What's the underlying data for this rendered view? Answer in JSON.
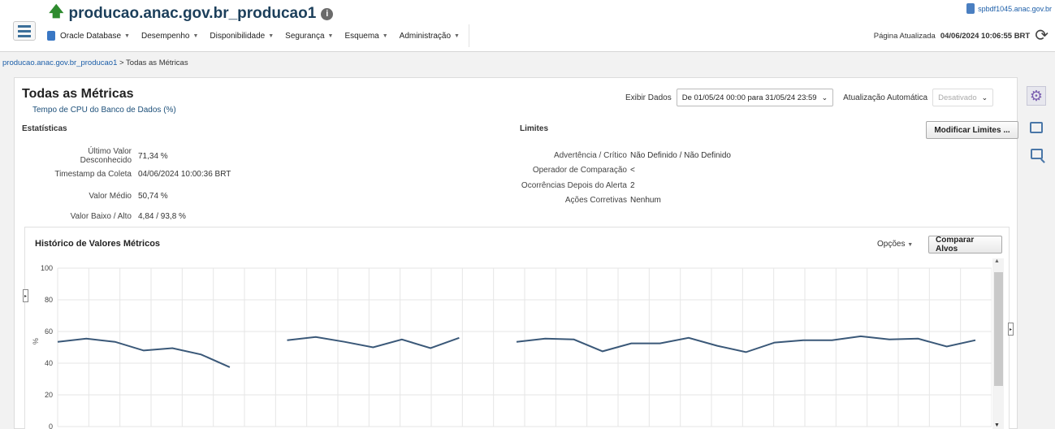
{
  "header": {
    "target_name": "producao.anac.gov.br_producao1",
    "host": "spbdf1045.anac.gov.br",
    "menus": [
      {
        "label": "Oracle Database"
      },
      {
        "label": "Desempenho"
      },
      {
        "label": "Disponibilidade"
      },
      {
        "label": "Segurança"
      },
      {
        "label": "Esquema"
      },
      {
        "label": "Administração"
      }
    ],
    "refresh_label": "Página Atualizada",
    "refresh_time": "04/06/2024 10:06:55 BRT"
  },
  "breadcrumb": {
    "link": "producao.anac.gov.br_producao1",
    "separator": " > ",
    "current": "Todas as Métricas"
  },
  "page": {
    "title": "Todas as Métricas",
    "metric": "Tempo de CPU do Banco de Dados (%)",
    "exibir_label": "Exibir Dados",
    "exibir_value": "De 01/05/24 00:00 para 31/05/24 23:59",
    "auto_label": "Atualização Automática",
    "auto_value": "Desativado"
  },
  "stats": {
    "heading": "Estatísticas",
    "rows": [
      {
        "label": "Último Valor Desconhecido",
        "label_line1": "Último Valor",
        "label_line2": "Desconhecido",
        "value": "71,34 %"
      },
      {
        "label": "Timestamp da Coleta",
        "value": "04/06/2024 10:00:36 BRT"
      },
      {
        "label": "Valor Médio",
        "value": "50,74 %"
      },
      {
        "label": "Valor Baixo / Alto",
        "value": "4,84 / 93,8 %"
      }
    ]
  },
  "limits": {
    "heading": "Limites",
    "modify_button": "Modificar Limites ...",
    "rows": [
      {
        "label": "Advertência / Crítico",
        "value": "Não Definido / Não Definido"
      },
      {
        "label": "Operador de Comparação",
        "value": "<"
      },
      {
        "label": "Ocorrências Depois do Alerta",
        "value": "2"
      },
      {
        "label": "Ações Corretivas",
        "value": "Nenhum"
      }
    ]
  },
  "chart_section": {
    "title": "Histórico de Valores Métricos",
    "options_label": "Opções",
    "compare_button": "Comparar Alvos"
  },
  "colors": {
    "line": "#3a5878",
    "grid": "#e6e6e6",
    "title": "#1c3f5b"
  },
  "chart_data": {
    "type": "line",
    "ylabel": "%",
    "ylim": [
      0,
      100
    ],
    "yticks": [
      0,
      20,
      40,
      60,
      80,
      100
    ],
    "grid": true,
    "segments": [
      [
        53.5,
        55.5,
        53.5,
        48,
        49.5,
        45.5,
        37.5
      ],
      [
        54.5,
        56.5,
        53.5,
        50,
        55,
        49.5,
        56
      ],
      [
        53.5,
        55.5,
        55,
        47.5,
        52.5,
        52.5,
        56,
        51,
        47,
        53,
        54.5,
        54.5,
        57,
        55,
        55.5,
        50.5,
        54.5
      ]
    ]
  }
}
